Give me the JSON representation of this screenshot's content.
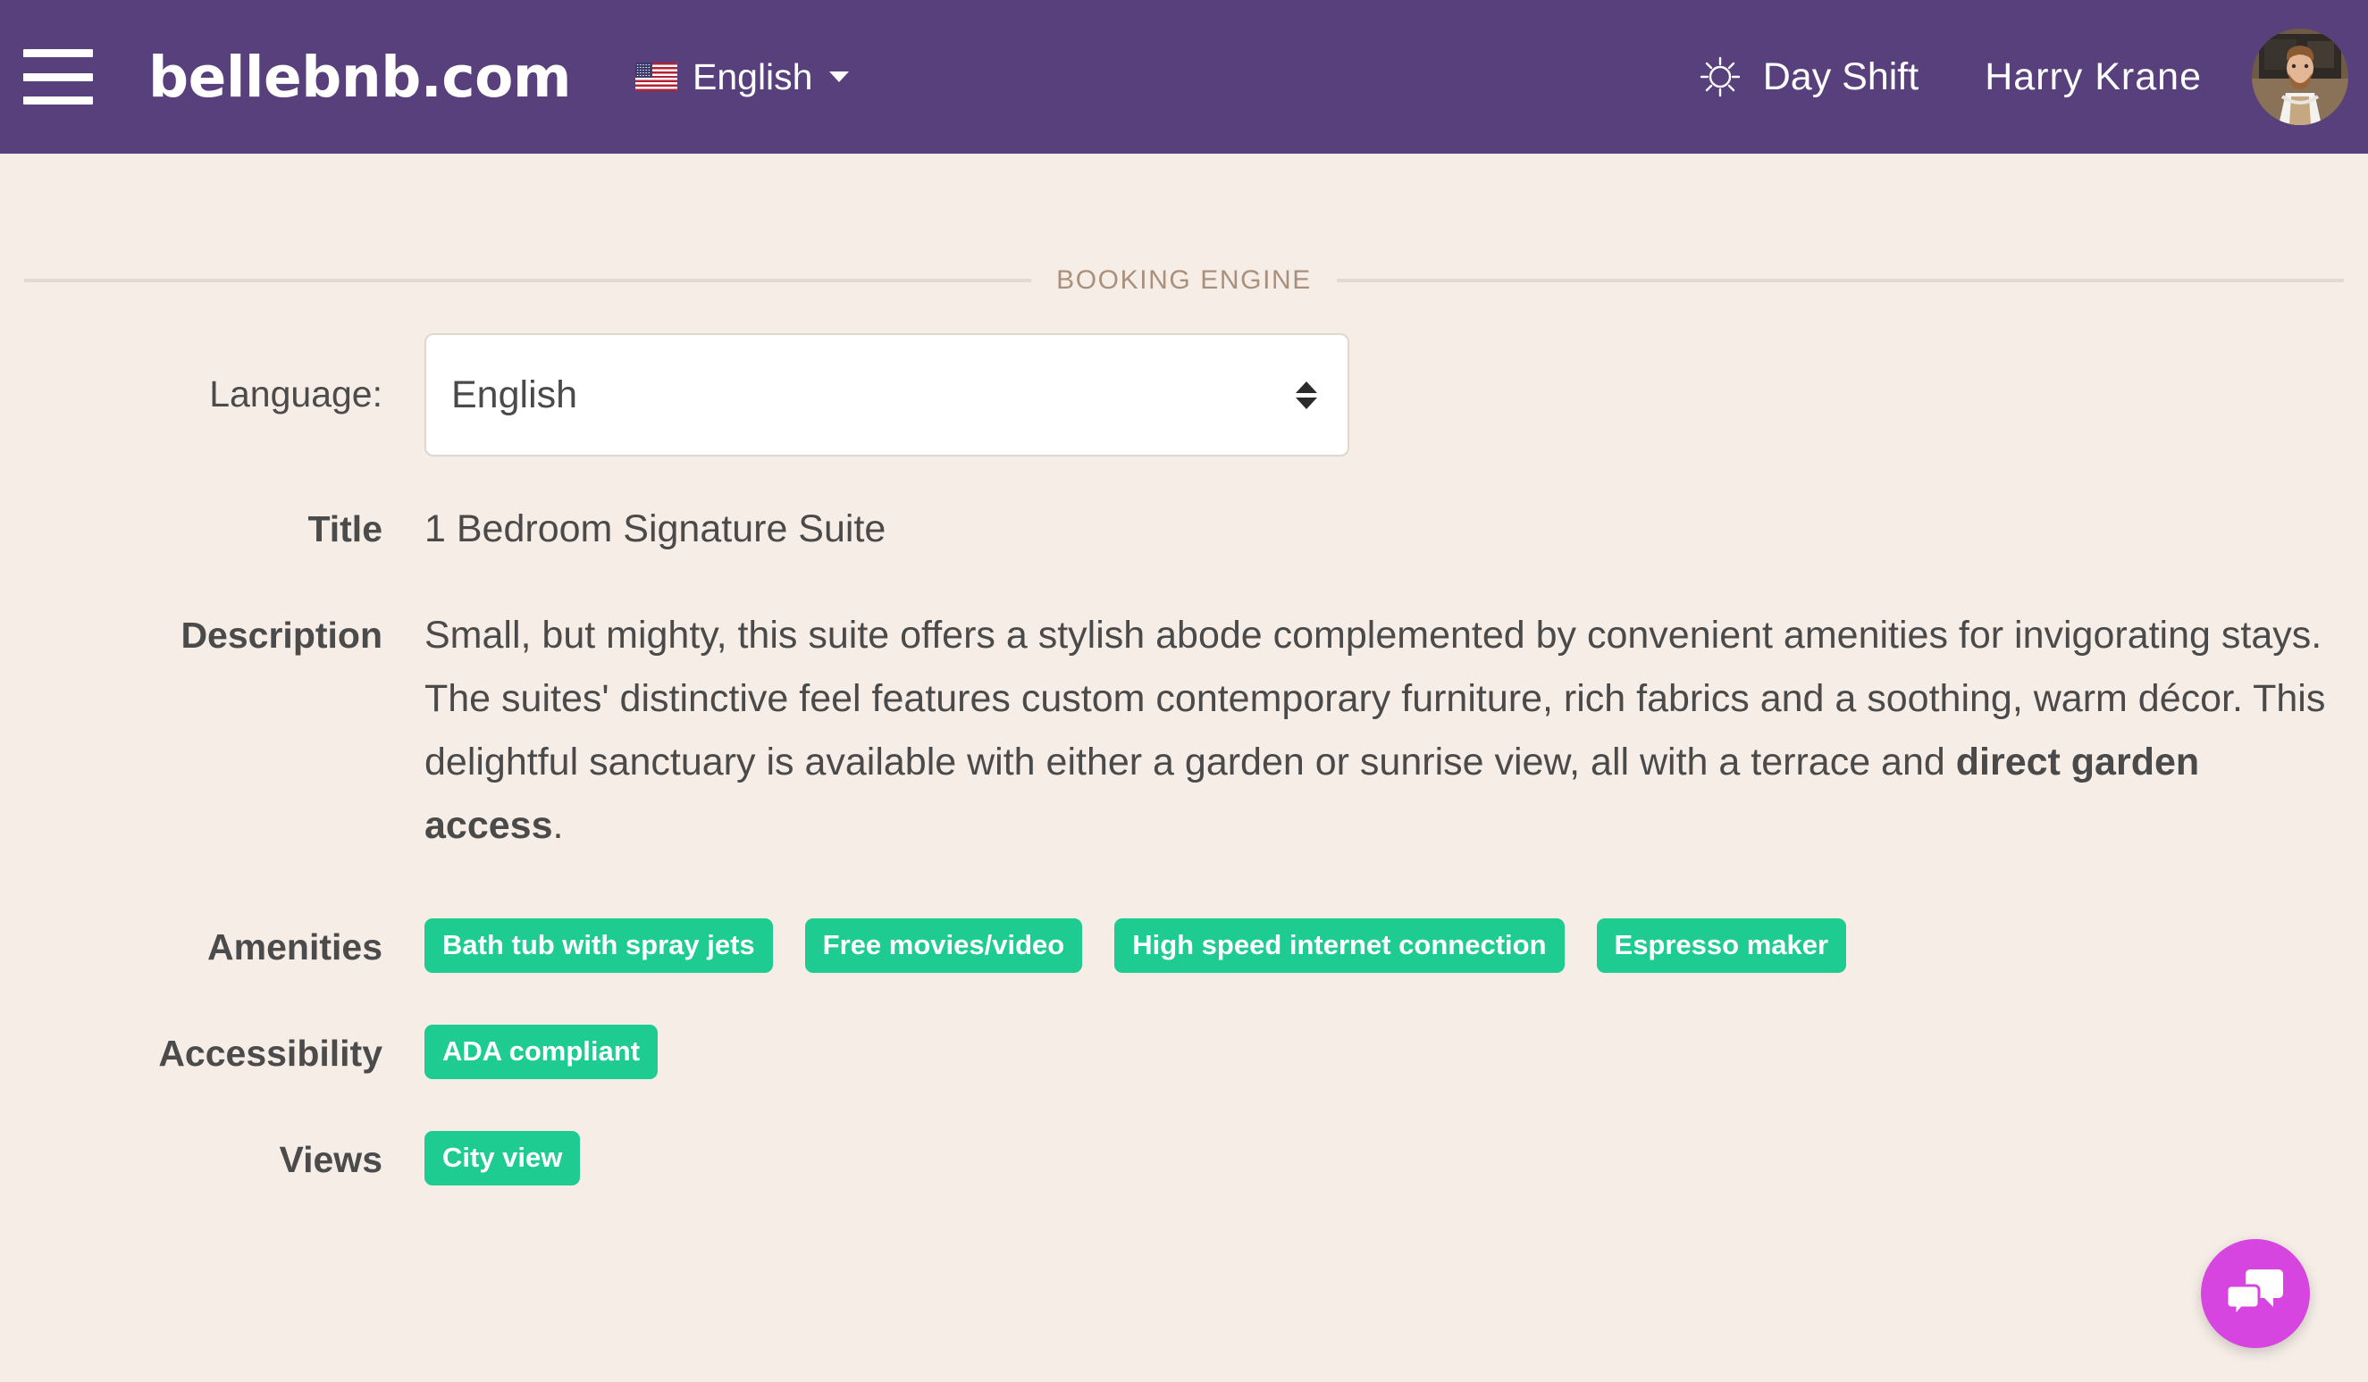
{
  "header": {
    "menu_icon": "hamburger-menu-icon",
    "brand": "bellebnb.com",
    "language_switch": {
      "flag_icon": "us-flag-icon",
      "label": "English",
      "caret_icon": "caret-down-icon"
    },
    "shift": {
      "icon": "sun-icon",
      "label": "Day Shift"
    },
    "user_name": "Harry Krane",
    "avatar_icon": "user-avatar"
  },
  "section": {
    "title": "BOOKING ENGINE"
  },
  "form": {
    "language": {
      "label": "Language:",
      "selected": "English",
      "options": [
        "English"
      ],
      "arrow_icon": "select-arrows-icon"
    },
    "title": {
      "label": "Title",
      "value": "1 Bedroom Signature Suite"
    },
    "description": {
      "label": "Description",
      "text_before_bold": "Small, but mighty, this suite offers a stylish abode complemented by convenient amenities for invigorating stays. The suites' distinctive feel features custom contemporary furniture, rich fabrics and a soothing, warm décor. This delightful sanctuary is available with either a garden or sunrise view, all with a terrace and ",
      "bold_text": "direct garden access",
      "text_after_bold": "."
    },
    "amenities": {
      "label": "Amenities",
      "items": [
        "Bath tub with spray jets",
        "Free movies/video",
        "High speed internet connection",
        "Espresso maker"
      ]
    },
    "accessibility": {
      "label": "Accessibility",
      "items": [
        "ADA compliant"
      ]
    },
    "views": {
      "label": "Views",
      "items": [
        "City view"
      ]
    }
  },
  "chat": {
    "icon": "chat-bubbles-icon"
  },
  "colors": {
    "navbar_purple": "#57407C",
    "page_background": "#F6EDE7",
    "badge_green": "#1ECB90",
    "section_title": "#A9907C",
    "divider": "#E2DACF",
    "chat_fab": "#D645E0"
  }
}
